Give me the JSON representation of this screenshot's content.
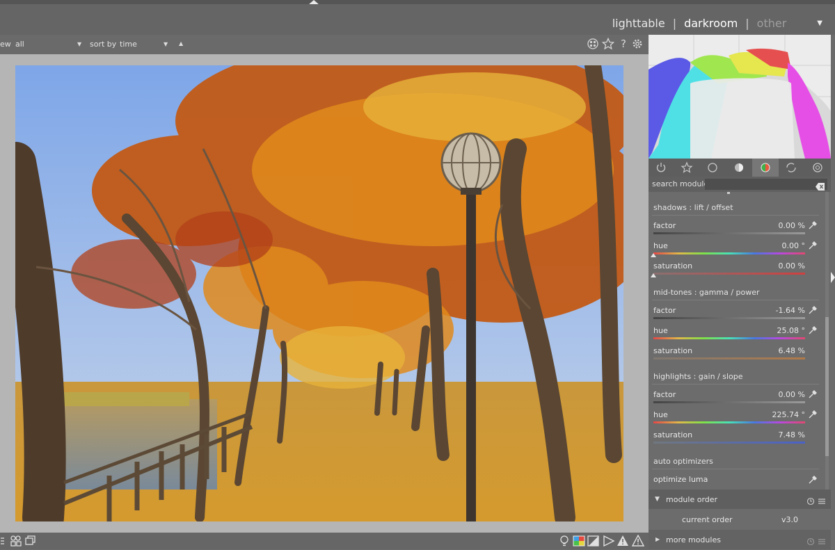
{
  "views": {
    "lighttable": "lighttable",
    "darkroom": "darkroom",
    "other": "other",
    "separator": "|"
  },
  "toolbar": {
    "view_label": "ew",
    "view_value": "all",
    "sort_label": "sort by",
    "sort_value": "time"
  },
  "panel": {
    "search_label": "search module",
    "module_order_label": "module order",
    "current_order_label": "current order",
    "current_order_value": "v3.0",
    "more_modules_label": "more modules"
  },
  "color_balance": {
    "shadows": {
      "title": "shadows : lift / offset",
      "factor_label": "factor",
      "factor_value": "0.00 %",
      "factor_level": 0.5,
      "hue_label": "hue",
      "hue_value": "0.00 °",
      "hue_level": 0.0,
      "saturation_label": "saturation",
      "saturation_value": "0.00 %",
      "saturation_level": 0.0
    },
    "midtones": {
      "title": "mid-tones : gamma / power",
      "factor_label": "factor",
      "factor_value": "-1.64 %",
      "factor_level": 0.48,
      "hue_label": "hue",
      "hue_value": "25.08 °",
      "hue_level": 0.07,
      "saturation_label": "saturation",
      "saturation_value": "6.48 %",
      "saturation_level": 0.32
    },
    "highlights": {
      "title": "highlights : gain / slope",
      "factor_label": "factor",
      "factor_value": "0.00 %",
      "factor_level": 0.5,
      "hue_label": "hue",
      "hue_value": "225.74 °",
      "hue_level": 0.63,
      "saturation_label": "saturation",
      "saturation_value": "7.48 %",
      "saturation_level": 0.3
    },
    "auto_title": "auto optimizers",
    "optimize_label": "optimize luma"
  },
  "icons": {
    "toolbar": [
      "grouping-icon",
      "star-icon",
      "help-icon",
      "gear-icon"
    ],
    "bottom": [
      "grid-icon",
      "styles-icon",
      "duplicate-icon"
    ],
    "bottom_right": [
      "bulb-icon",
      "softproof-icon",
      "gamut-icon",
      "focus-peak-icon",
      "overexposed-icon",
      "raw-overexposed-icon"
    ],
    "module_tabs": [
      "power-icon",
      "favorite-icon",
      "basic-icon",
      "tone-icon",
      "color-icon",
      "correct-icon",
      "effect-icon"
    ]
  },
  "colors": {
    "accent_active_tab": "#777777",
    "panel_bg": "#6c6c6c",
    "center_bg": "#b5b5b5"
  }
}
